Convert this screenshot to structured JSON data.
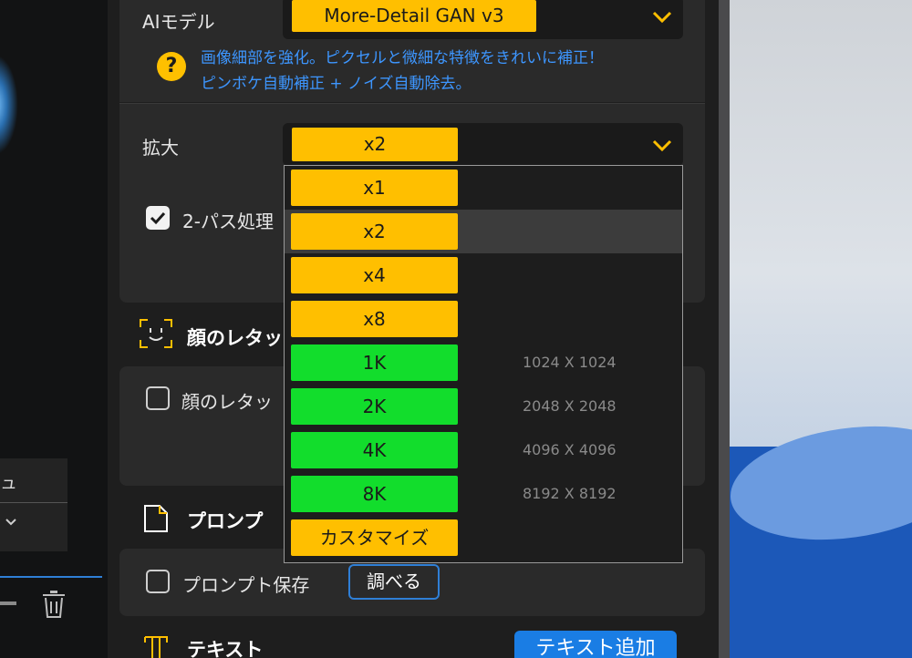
{
  "ai_model": {
    "label": "AIモデル",
    "selected": "More-Detail GAN  v3",
    "hint_line1": "画像細部を強化。ピクセルと微細な特徴をきれいに補正！",
    "hint_line2": "ピンボケ自動補正 + ノイズ自動除去。"
  },
  "upscale": {
    "label": "拡大",
    "selected": "x2",
    "two_pass_label": "2-パス処理",
    "options": [
      {
        "label": "x1",
        "resolution": "",
        "kind": "multiplier"
      },
      {
        "label": "x2",
        "resolution": "",
        "kind": "multiplier"
      },
      {
        "label": "x4",
        "resolution": "",
        "kind": "multiplier"
      },
      {
        "label": "x8",
        "resolution": "",
        "kind": "multiplier"
      },
      {
        "label": "1K",
        "resolution": "1024 X 1024",
        "kind": "fixed"
      },
      {
        "label": "2K",
        "resolution": "2048 X 2048",
        "kind": "fixed"
      },
      {
        "label": "4K",
        "resolution": "4096 X 4096",
        "kind": "fixed"
      },
      {
        "label": "8K",
        "resolution": "8192 X 8192",
        "kind": "fixed"
      },
      {
        "label": "カスタマイズ",
        "resolution": "",
        "kind": "custom"
      }
    ]
  },
  "face": {
    "heading": "顔のレタッ",
    "checkbox_label": "顔のレタッ"
  },
  "prompt": {
    "heading": "プロンプ",
    "save_label": "プロンプト保存",
    "browse_button": "調べる"
  },
  "text": {
    "heading": "テキスト",
    "add_button": "テキスト追加"
  },
  "left_panel": {
    "label": "ュ"
  },
  "colors": {
    "accent_yellow": "#ffbf00",
    "accent_green": "#12dd2c",
    "link_blue": "#3d96ff",
    "button_blue": "#1a7de4"
  }
}
